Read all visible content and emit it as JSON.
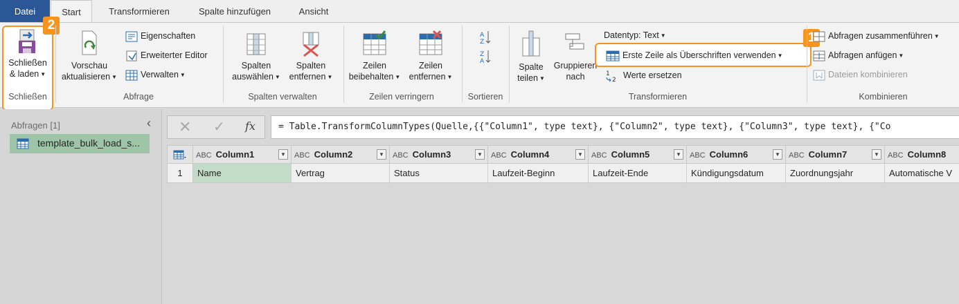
{
  "menu": {
    "tabs": [
      "Datei",
      "Start",
      "Transformieren",
      "Spalte hinzufügen",
      "Ansicht"
    ]
  },
  "ribbon": {
    "close_load": {
      "line1": "Schließen",
      "line2": "& laden",
      "group": "Schließen"
    },
    "query": {
      "preview_line1": "Vorschau",
      "preview_line2": "aktualisieren",
      "properties": "Eigenschaften",
      "advanced_editor": "Erweiterter Editor",
      "manage": "Verwalten",
      "group": "Abfrage"
    },
    "columns": {
      "choose_line1": "Spalten",
      "choose_line2": "auswählen",
      "remove_line1": "Spalten",
      "remove_line2": "entfernen",
      "group": "Spalten verwalten"
    },
    "rows": {
      "keep_line1": "Zeilen",
      "keep_line2": "beibehalten",
      "remove_line1": "Zeilen",
      "remove_line2": "entfernen",
      "group": "Zeilen verringern"
    },
    "sort": {
      "group": "Sortieren"
    },
    "transform": {
      "split_line1": "Spalte",
      "split_line2": "teilen",
      "group_by_line1": "Gruppieren",
      "group_by_line2": "nach",
      "datatype": "Datentyp: Text",
      "first_row_header": "Erste Zeile als Überschriften verwenden",
      "replace_values": "Werte ersetzen",
      "group": "Transformieren"
    },
    "combine": {
      "merge": "Abfragen zusammenführen",
      "append": "Abfragen anfügen",
      "combine_files": "Dateien kombinieren",
      "group": "Kombinieren"
    }
  },
  "badges": {
    "one": "1",
    "two": "2"
  },
  "queries": {
    "header": "Abfragen [1]",
    "items": [
      {
        "label": "template_bulk_load_s..."
      }
    ]
  },
  "formula": {
    "fx": "fx",
    "text": "= Table.TransformColumnTypes(Quelle,{{\"Column1\", type text}, {\"Column2\", type text}, {\"Column3\", type text}, {\"Co"
  },
  "table": {
    "type_label": "ABC",
    "columns": [
      "Column1",
      "Column2",
      "Column3",
      "Column4",
      "Column5",
      "Column6",
      "Column7",
      "Column8"
    ],
    "rows": [
      {
        "num": "1",
        "cells": [
          "Name",
          "Vertrag",
          "Status",
          "Laufzeit-Beginn",
          "Laufzeit-Ende",
          "Kündigungsdatum",
          "Zuordnungsjahr",
          "Automatische V"
        ]
      }
    ]
  },
  "colors": {
    "file_tab": "#2b5797",
    "highlight": "#f7941d",
    "selected_query": "#9fc5a8",
    "selected_cell": "#c2dcc7"
  }
}
